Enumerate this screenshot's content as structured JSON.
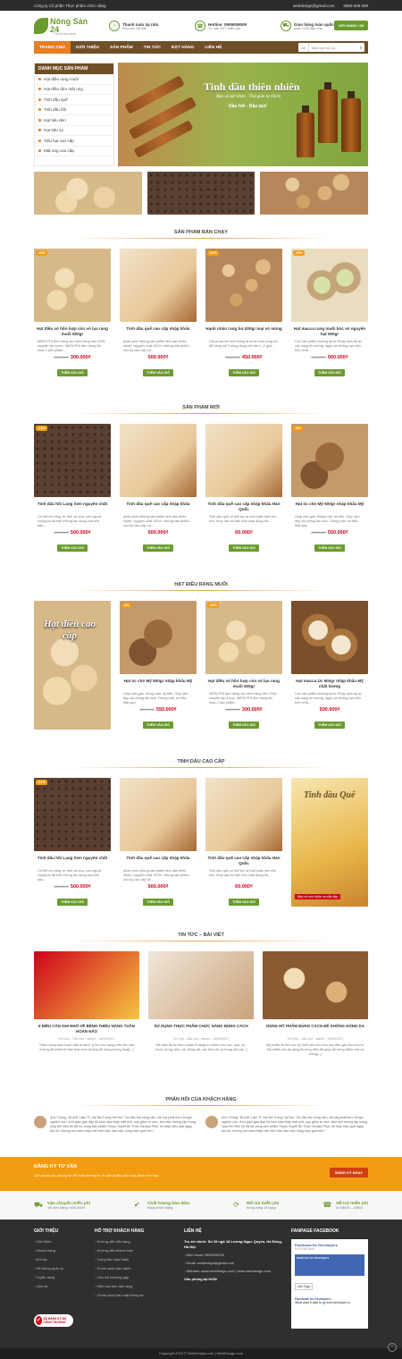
{
  "topbar": {
    "left": "Công ty Cổ phần Thực phẩm chức năng",
    "email": "webdesign@gmail.com",
    "phone": "0909 009 009"
  },
  "header": {
    "logo": "Nông Sản 24",
    "logo_badge": "24h",
    "slogan": "Tốt cho sức khỏe",
    "info": [
      {
        "icon": "location-icon",
        "title": "Thanh toán tại nhà",
        "sub": "Khu vực Hà Nội"
      },
      {
        "icon": "phone-icon",
        "title": "Hotline: 0909009009",
        "sub": "Tư vấn 24/7 miễn phí"
      },
      {
        "icon": "truck-icon",
        "title": "Giao hàng toàn quốc",
        "sub": "nhận COD tận nhà"
      }
    ],
    "cart_label": "GIỎ HÀNG / 0đ"
  },
  "nav": {
    "items": [
      "TRANG CHỦ",
      "GIỚI THIỆU",
      "SẢN PHẨM",
      "TIN TỨC",
      "ĐẶT HÀNG",
      "LIÊN HỆ"
    ],
    "search_select": "All",
    "search_placeholder": "Bạn cần tìm gì..."
  },
  "sidebar": {
    "title": "DANH MỤC SẢN PHẨM",
    "items": [
      "Hạt điều rang muối",
      "Hạt điều tẩm mật ong",
      "Tinh dầu quế",
      "Tinh dầu hồi",
      "Hạt tiêu đen",
      "Hạt tiêu sọ",
      "Tiêu hạt cao cấp",
      "Mật ong cao cấp"
    ]
  },
  "banner": {
    "title": "Tinh dầu thiên nhiên",
    "subtitle": "Bảo vệ sức khỏe · Thư giãn tự nhiên",
    "extra": "Dầu hồi - Dầu quế"
  },
  "sections": [
    {
      "title": "SẢN PHẨM BÁN CHẠY",
      "products": [
        {
          "badge": "-46%",
          "img": "cashew",
          "name": "Hạt điều vỏ hồn hợp còn vỏ lụa rang muối 500gr",
          "desc": "MIỄN PHÍ đơn hàng cho đơn hàng trên 200k chuyển tận trước. MIỄN PHÍ đơn hàng khi mua 2 sản phẩm...",
          "old": "560.000₫",
          "price": "300.000₫"
        },
        {
          "badge": "",
          "img": "oil",
          "name": "Tinh dầu quế cao cấp nhập khẩu",
          "desc": "phân phối những sản phẩm tinh dầu thiên nhiên, nguyên chất 100%, những sản phẩm cực kỳ cao cấp và...",
          "old": "",
          "price": "500.000₫"
        },
        {
          "badge": "-20%",
          "img": "nut",
          "name": "Hạnh nhân rang bơ 400gr loại vỏ mỏng",
          "desc": "Dicnel secret love Đang là nước hoa vùng kín đã hàng với 2 công dụng chỉ cần 1 -2 giọt...",
          "old": "560.000₫",
          "price": "450.000₫"
        },
        {
          "badge": "-25%",
          "img": "pistachio",
          "name": "Hạt macca rang muối bóc vỏ nguyên hạt 500gr",
          "desc": "Các sản phẩm dưỡng da từ Pháp luôn được các nàng tin tưởng, ngay cả những bạn khó tính nhất...",
          "old": "750.000₫",
          "price": "560.000₫"
        }
      ]
    },
    {
      "title": "SẢN PHẨM MỚI",
      "products": [
        {
          "badge": "-21%",
          "img": "pepper",
          "name": "Tinh dầu hồi Lạng Sơn nguyên chất",
          "desc": "Có thể nói rằng, từ thời xa xưa, con người chúng ta đã biết những tác dụng của tinh dầu...",
          "old": "630.000₫",
          "price": "500.000₫"
        },
        {
          "badge": "",
          "img": "oil",
          "name": "Tinh dầu quế cao cấp nhập khẩu",
          "desc": "phân phối những sản phẩm tinh dầu thiên nhiên, nguyên chất 100%, những sản phẩm cực kỳ cao cấp và...",
          "old": "",
          "price": "500.000₫"
        },
        {
          "badge": "",
          "img": "oil",
          "name": "Tinh dầu quế cao cấp nhập khẩu Hàn Quốc",
          "desc": "Tinh dầu quế có thể tạo ra hoả hoặc làm cho bộc, thuỷ dấu hộ tiêu hóa hoạt động tốt...",
          "old": "",
          "price": "60.000₫"
        },
        {
          "badge": "-8%",
          "img": "walnut",
          "name": "Hạt óc chó Mỹ 500gr nhập khẩu Mỹ",
          "desc": "Giúp mát gan, thông mật, lợi tiểu. Giúp làm đẹp da chống lão hóa. Thông mật, lợi tiểu. Mát gan",
          "old": "600.000₫",
          "price": "550.000₫"
        }
      ]
    },
    {
      "title": "HẠT ĐIỀU RANG MUỐI",
      "banner": "Hạt điều cao cấp",
      "products": [
        {
          "badge": "-8%",
          "img": "walnut",
          "name": "Hạt óc chó Mỹ 500gr nhập khẩu Mỹ",
          "desc": "Giúp mát gan, thông mật, lợi tiểu. Giúp làm đẹp da chống lão hóa. Thông mật, lợi tiểu. Mát gan",
          "old": "600.000₫",
          "price": "550.000₫"
        },
        {
          "badge": "-46%",
          "img": "cashew",
          "name": "Hạt điều vỏ hồn hợp còn vỏ lụa rang muối 500gr",
          "desc": "MIỄN PHÍ đơn hàng cho đơn hàng trên 200k chuyển tận trước. MIỄN PHÍ đơn hàng khi mua 2 sản phẩm...",
          "old": "560.000₫",
          "price": "300.000₫"
        },
        {
          "badge": "",
          "img": "mac",
          "name": "Hạt macca Úc 500gr nhập khẩu Mỹ chất lượng",
          "desc": "Các sản phẩm dưỡng da từ Pháp luôn được các nàng tin tưởng, ngay cả những bạn khó tính nhất...",
          "old": "",
          "price": "500.000₫"
        }
      ]
    },
    {
      "title": "TINH DẦU CAO CẤP",
      "banner": "Tinh dầu Quế",
      "banner_sub": "Bảo vệ sức khỏe và sắc đẹp",
      "products": [
        {
          "badge": "-21%",
          "img": "pepper",
          "name": "Tinh dầu hồi Lạng Sơn nguyên chất",
          "desc": "Có thể nói rằng, từ thời xa xưa, con người chúng ta đã biết những tác dụng của tinh dầu...",
          "old": "630.000₫",
          "price": "500.000₫"
        },
        {
          "badge": "",
          "img": "oil",
          "name": "Tinh dầu quế cao cấp nhập khẩu",
          "desc": "phân phối những sản phẩm tinh dầu thiên nhiên, nguyên chất 100%, những sản phẩm cực kỳ cao cấp và...",
          "old": "",
          "price": "500.000₫"
        },
        {
          "badge": "",
          "img": "oil",
          "name": "Tinh dầu quế cao cấp nhập khẩu Hàn Quốc",
          "desc": "Tinh dầu quế có thể tạo ra hoả hoặc làm cho bộc, thuỷ dấu hộ tiêu hóa hoạt động tốt...",
          "old": "",
          "price": "60.000₫"
        }
      ]
    }
  ],
  "add_to_cart": "THÊM VÀO GIỎ",
  "news": {
    "title": "TIN TỨC – BÀI VIẾT",
    "items": [
      {
        "title": "6 ĐIỀU CẦN GHI NHỚ VỀ BỆNH THIẾU NĂNG TUẦN HOÀN NÃO",
        "cat": "Tin Sức - Sắc voố",
        "author": "admin",
        "date": "14/09/2017",
        "desc": "Thiếu năng tuần hoàn não là bệnh lý khi tình trạng máu lên não không đủ khiến tế bào thần kinh không đủ năng lượng hoạt[...]"
      },
      {
        "title": "SỬ DỤNG THỰC PHẨM CHỨC NĂNG ĐÚNG CÁCH",
        "cat": "Tin Tức - Sắc voố",
        "author": "admin",
        "date": "14/09/2017",
        "desc": "Để hiểu được thực phẩm ở dạng tự nhiên như rau, quả, củ, chua, trứng, tôm, cá, bông cải, các bữa ăn có trong thịt ca[...]"
      },
      {
        "title": "DÙNG MỸ PHẨM ĐÚNG CÁCH ĐỂ KHÔNG HỎNG DA",
        "cat": "Tin Sức - Sắc voố",
        "author": "admin",
        "date": "14/09/2017",
        "desc": "Mỹ phẩm là thứ cực kỳ thiết yếu cho nhu cầu tắm gội của chị em. Mỹ phẩm với đa dạng thương hiệu đã giúp đỡ trang điểm một số trang[...]"
      }
    ]
  },
  "testimonials": {
    "title": "PHẢN HỒI CỦA KHÁCH HÀNG",
    "items": [
      {
        "text": "Anh Thông, 38 tuổi, Lâm Tỉ, Hai Bà Trưng Hà Nội: \"Do đặc thù công việc, tôi hay phải thức khuya nghiên cứu, thời gian gần đây tôi luôn cảm thấy mệt mỏi, suy giảm trí nhớ, làm việc không tập trung. Qua tìm hiểu tôi đã sử dụng sản phẩm Thuốc Huyết Ăn Thần Tanaka Plus, tôi thấy hiệu quả ngay tức thì, không còn cảm thấy mệt mỏi nữa, làm việc cũng hiệu quả hơn.\""
      },
      {
        "text": "Anh Thông, 38 tuổi, Lâm Tỉ, Hai Bà Trưng Hà Nội: \"Do đặc thù công việc, tôi hay phải thức khuya nghiên cứu, thời gian gần đây tôi luôn cảm thấy mệt mỏi, suy giảm trí nhớ, làm việc không tập trung. Qua tìm hiểu tôi đã sử dụng sản phẩm Thuốc Huyết Ăn Thần Tanaka Plus, tôi thấy hiệu quả ngay tức thì, không còn cảm thấy mệt mỏi nữa, làm việc cũng hiệu quả hơn.\""
      }
    ]
  },
  "newsletter": {
    "title": "ĐĂNG KÝ TƯ VẤN",
    "sub": "Gửi email cho chúng tôi để nhận thông tin về sản phẩm phù hợp dành cho bạn",
    "button": "ĐĂNG KÝ NGAY"
  },
  "features": [
    {
      "icon": "truck-icon",
      "title": "Vận chuyển miễn phí",
      "sub": "với đơn hàng >600.000đ"
    },
    {
      "icon": "check-icon",
      "title": "Chất lượng bảo đảm",
      "sub": "hàng chính hãng"
    },
    {
      "icon": "refresh-icon",
      "title": "Đổi trả miễn phí",
      "sub": "trong vòng 15 ngày"
    },
    {
      "icon": "phone-icon",
      "title": "Hỗ trợ miễn phí",
      "sub": "từ 08h00 – 23h00"
    }
  ],
  "footer": {
    "col1": {
      "title": "GIỚI THIỆU",
      "links": [
        "Giới thiệu",
        "Khách hàng",
        "Đối tác",
        "Hệ thống quản lý",
        "Tuyển dụng",
        "Liên hệ"
      ]
    },
    "col2": {
      "title": "HỖ TRỢ KHÁCH HÀNG",
      "links": [
        "Hướng dẫn đặt hàng",
        "Hướng dẫn thanh toán",
        "Trung tâm bảo hành",
        "Chính sách bảo hành",
        "Câu hỏi thường gặp",
        "Kiểm tra đơn đặt hàng",
        "Chính sách bảo mật thông tin"
      ]
    },
    "contact": {
      "title": "LIÊN HỆ",
      "lines": [
        "Trụ sở chính: Số 29 ngõ 18 Lương Ngọc Quyến, Hà Đông, Hà Nội.",
        "- Điện thoại: 0909009009",
        "- Email: webdesign@gmail.com",
        "- Website: www.webdesign.com | www.webdesign.com",
        "Văn phòng tại HCM"
      ]
    },
    "fbpage": {
      "title": "FANPAGE FACEBOOK",
      "name": "Facebook for Developers",
      "likes": "5,005,962 likes",
      "cover_text": "facebook for developers",
      "like_btn": "Like Page",
      "post_name": "Facebook for Developers",
      "post_text": "What does it take to go from developer to"
    },
    "badge": "ĐÃ ĐĂNG KÝ BỘ CÔNG THƯƠNG",
    "copyright": "Copyright 2019 © WebDesign.com | WebDesign.com"
  }
}
